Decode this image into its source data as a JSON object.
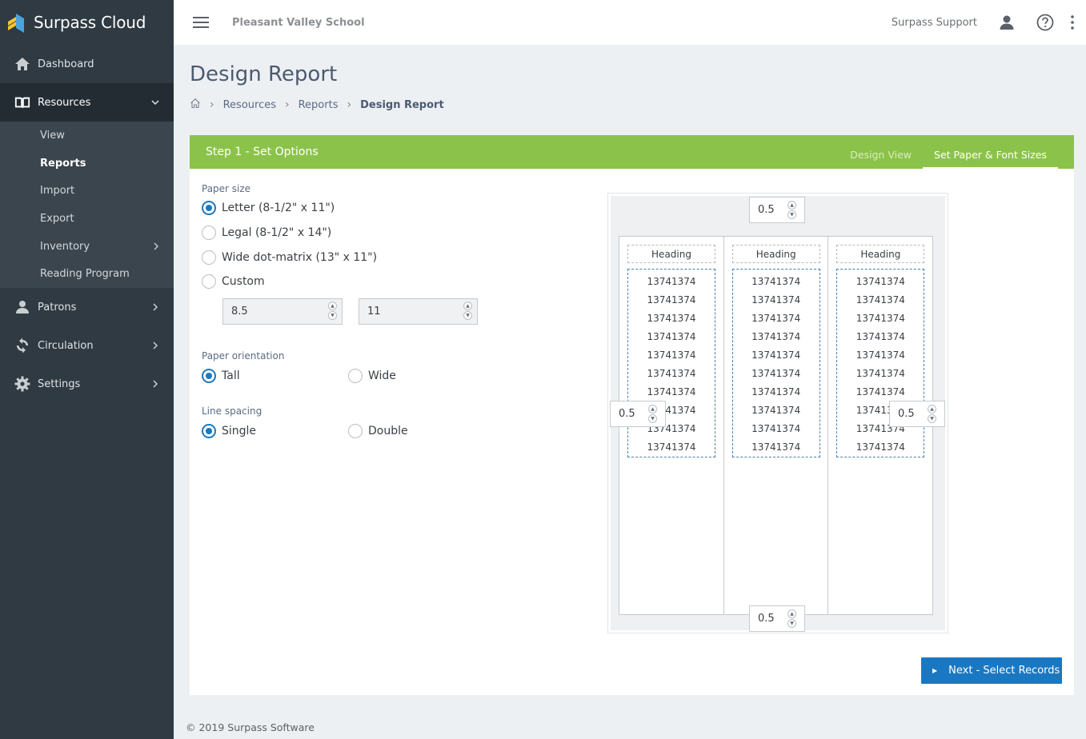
{
  "brand": {
    "name": "Surpass Cloud"
  },
  "sidebar": {
    "items": [
      {
        "label": "Dashboard"
      },
      {
        "label": "Resources"
      },
      {
        "label": "Patrons"
      },
      {
        "label": "Circulation"
      },
      {
        "label": "Settings"
      }
    ],
    "resources_sub": [
      {
        "label": "View"
      },
      {
        "label": "Reports"
      },
      {
        "label": "Import"
      },
      {
        "label": "Export"
      },
      {
        "label": "Inventory"
      },
      {
        "label": "Reading Program"
      }
    ]
  },
  "topbar": {
    "school": "Pleasant Valley School",
    "user": "Surpass Support"
  },
  "page": {
    "title": "Design Report"
  },
  "breadcrumb": {
    "resources": "Resources",
    "reports": "Reports",
    "current": "Design Report"
  },
  "card": {
    "title": "Step 1 - Set Options",
    "tabs": [
      {
        "label": "Design View"
      },
      {
        "label": "Set Paper & Font Sizes"
      }
    ]
  },
  "options": {
    "paper_size_label": "Paper size",
    "paper_sizes": [
      {
        "label": "Letter (8-1/2\" x 11\")",
        "checked": true
      },
      {
        "label": "Legal (8-1/2\" x 14\")",
        "checked": false
      },
      {
        "label": "Wide dot-matrix (13\" x 11\")",
        "checked": false
      },
      {
        "label": "Custom",
        "checked": false
      }
    ],
    "custom_width": "8.5",
    "custom_height": "11",
    "orientation_label": "Paper orientation",
    "orientation": [
      {
        "label": "Tall",
        "checked": true
      },
      {
        "label": "Wide",
        "checked": false
      }
    ],
    "spacing_label": "Line spacing",
    "spacing": [
      {
        "label": "Single",
        "checked": true
      },
      {
        "label": "Double",
        "checked": false
      }
    ]
  },
  "preview": {
    "margin_top": "0.5",
    "margin_bottom": "0.5",
    "margin_left": "0.5",
    "margin_right": "0.5",
    "columns": [
      {
        "heading": "Heading",
        "values": [
          "13741374",
          "13741374",
          "13741374",
          "13741374",
          "13741374",
          "13741374",
          "13741374",
          "13741374",
          "13741374",
          "13741374"
        ]
      },
      {
        "heading": "Heading",
        "values": [
          "13741374",
          "13741374",
          "13741374",
          "13741374",
          "13741374",
          "13741374",
          "13741374",
          "13741374",
          "13741374",
          "13741374"
        ]
      },
      {
        "heading": "Heading",
        "values": [
          "13741374",
          "13741374",
          "13741374",
          "13741374",
          "13741374",
          "13741374",
          "13741374",
          "13741374",
          "13741374",
          "13741374"
        ]
      }
    ]
  },
  "actions": {
    "next_label": "Next - Select Records"
  },
  "footer": {
    "text": "© 2019 Surpass Software"
  },
  "colors": {
    "accent": "#1a78c2",
    "header_green": "#8bc34a",
    "sidebar": "#2f3a42"
  }
}
